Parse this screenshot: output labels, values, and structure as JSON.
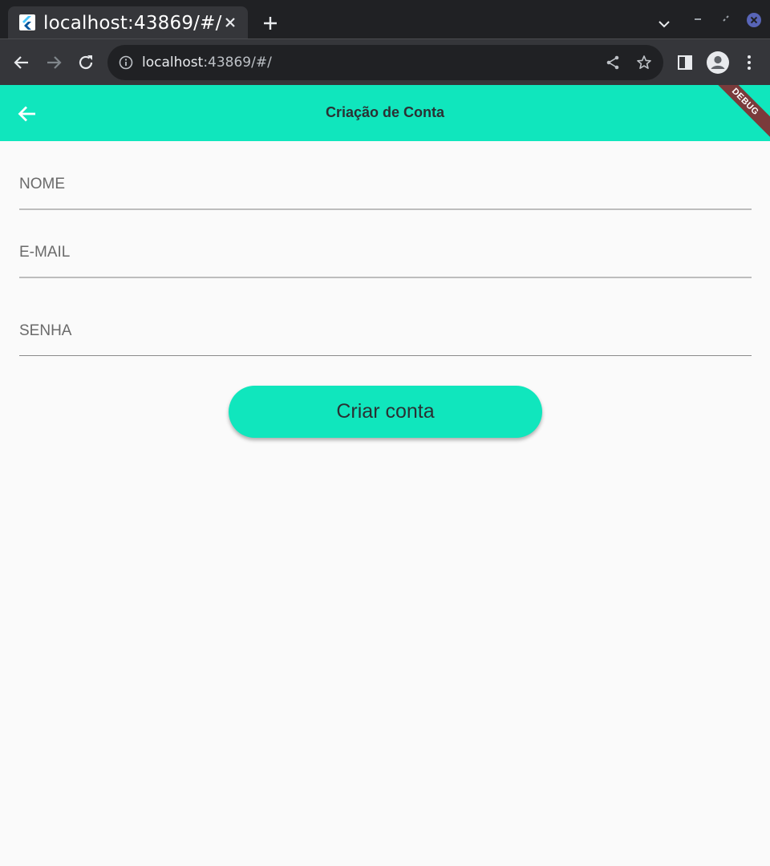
{
  "browser": {
    "tab_title": "localhost:43869/#/",
    "url_host": "localhost",
    "url_rest": ":43869/#/"
  },
  "appbar": {
    "title": "Criação de Conta",
    "debug_banner": "DEBUG",
    "color": "#10e6bd"
  },
  "form": {
    "fields": [
      {
        "label": "NOME",
        "value": ""
      },
      {
        "label": "E-MAIL",
        "value": ""
      },
      {
        "label": "SENHA",
        "value": ""
      }
    ],
    "submit_label": "Criar conta"
  },
  "icons": {
    "favicon": "flutter-icon",
    "tab_close": "close-icon",
    "new_tab": "plus-icon",
    "back": "arrow-left-icon",
    "forward": "arrow-right-icon",
    "reload": "reload-icon",
    "site_info": "info-icon",
    "share": "share-icon",
    "bookmark": "star-icon",
    "side_panel": "side-panel-icon",
    "profile": "avatar-icon",
    "menu": "kebab-menu-icon"
  }
}
